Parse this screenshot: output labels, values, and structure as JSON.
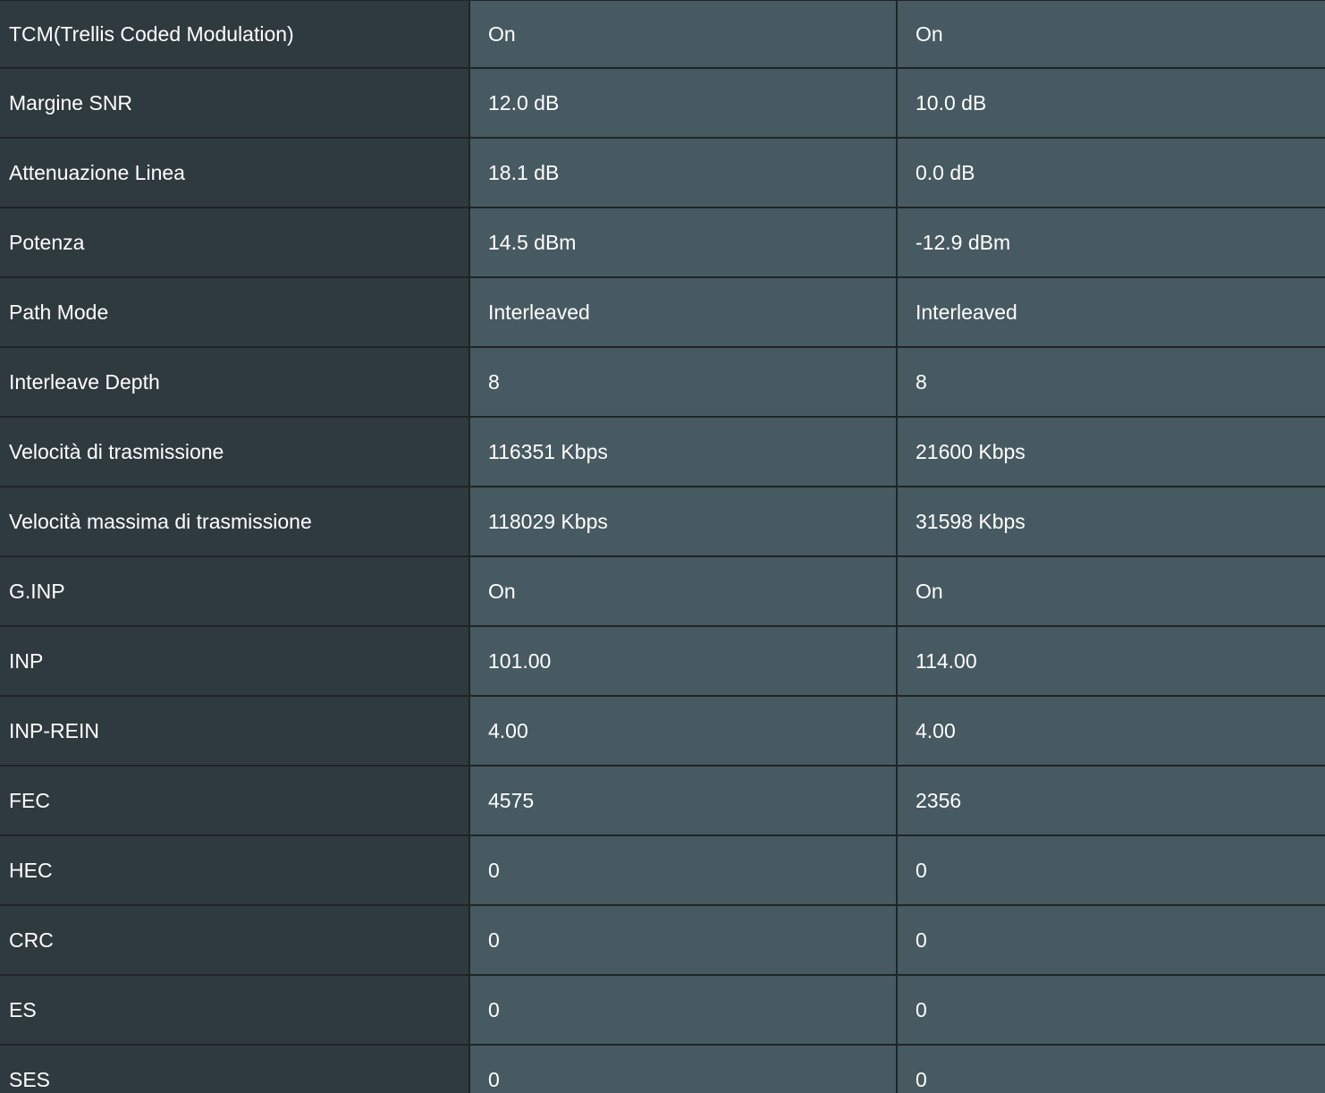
{
  "colors": {
    "label_column_bg": "#2f3a3f",
    "value_column_bg": "#475a61",
    "grid_line": "#1f2427",
    "text": "#ffffff"
  },
  "rows": [
    {
      "label": "TCM(Trellis Coded Modulation)",
      "downstream": "On",
      "upstream": "On"
    },
    {
      "label": "Margine SNR",
      "downstream": "12.0 dB",
      "upstream": "10.0 dB"
    },
    {
      "label": "Attenuazione Linea",
      "downstream": "18.1 dB",
      "upstream": "0.0 dB"
    },
    {
      "label": "Potenza",
      "downstream": "14.5 dBm",
      "upstream": "-12.9 dBm"
    },
    {
      "label": "Path Mode",
      "downstream": "Interleaved",
      "upstream": "Interleaved"
    },
    {
      "label": "Interleave Depth",
      "downstream": "8",
      "upstream": "8"
    },
    {
      "label": "Velocità di trasmissione",
      "downstream": "116351 Kbps",
      "upstream": "21600 Kbps"
    },
    {
      "label": "Velocità massima di trasmissione",
      "downstream": "118029 Kbps",
      "upstream": "31598 Kbps"
    },
    {
      "label": "G.INP",
      "downstream": "On",
      "upstream": "On"
    },
    {
      "label": "INP",
      "downstream": "101.00",
      "upstream": "114.00"
    },
    {
      "label": "INP-REIN",
      "downstream": "4.00",
      "upstream": "4.00"
    },
    {
      "label": "FEC",
      "downstream": "4575",
      "upstream": "2356"
    },
    {
      "label": "HEC",
      "downstream": "0",
      "upstream": "0"
    },
    {
      "label": "CRC",
      "downstream": "0",
      "upstream": "0"
    },
    {
      "label": "ES",
      "downstream": "0",
      "upstream": "0"
    },
    {
      "label": "SES",
      "downstream": "0",
      "upstream": "0"
    }
  ]
}
